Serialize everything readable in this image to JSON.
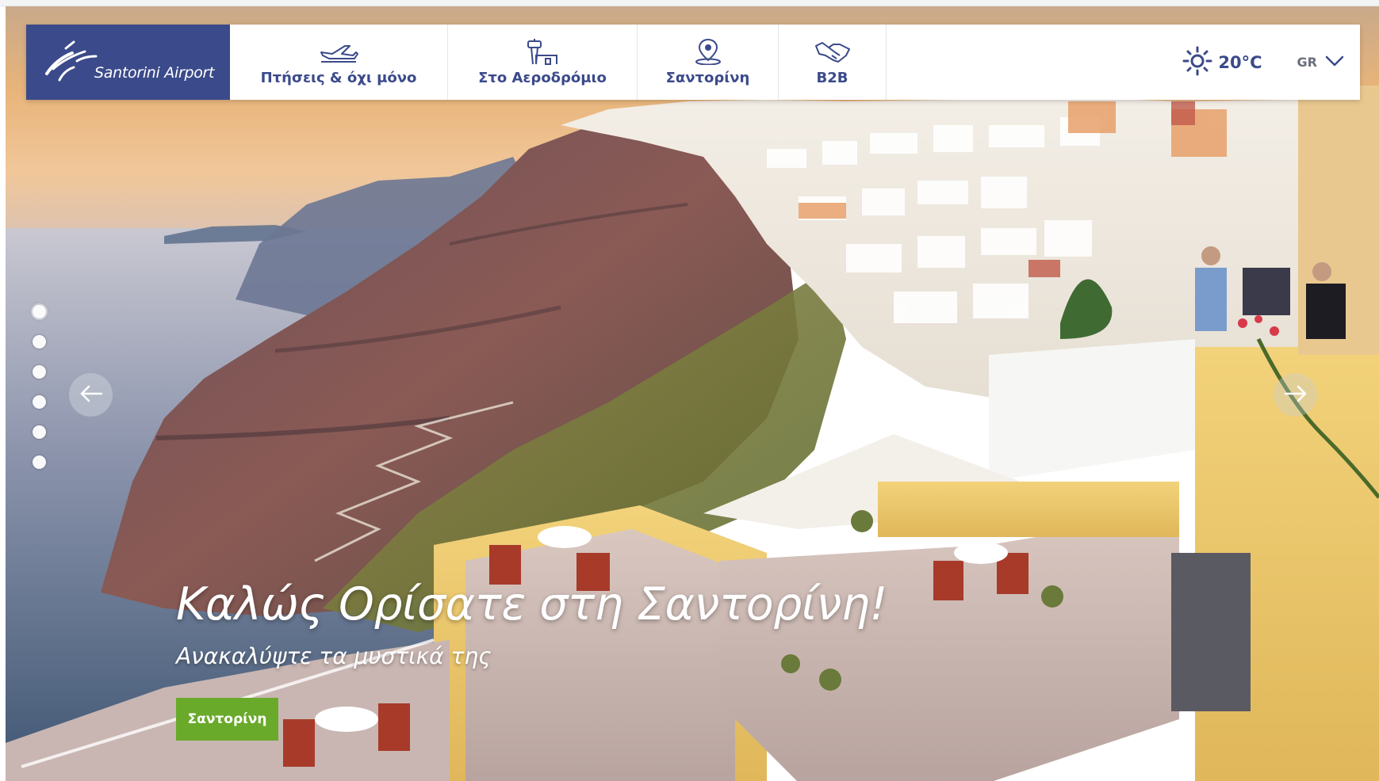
{
  "brand": {
    "name": "Santorini Airport",
    "primary_color": "#3b4a8a",
    "accent_green": "#6aaa2b"
  },
  "nav": {
    "items": [
      {
        "label": "Πτήσεις & όχι μόνο",
        "icon": "airplane-takeoff-icon"
      },
      {
        "label": "Στο Αεροδρόμιο",
        "icon": "control-tower-icon"
      },
      {
        "label": "Σαντορίνη",
        "icon": "location-pin-icon"
      },
      {
        "label": "B2B",
        "icon": "handshake-icon"
      }
    ]
  },
  "weather": {
    "icon": "sun-icon",
    "temperature": "20°C"
  },
  "language": {
    "code": "GR",
    "icon": "chevron-down-icon"
  },
  "slider": {
    "slide_count": 6,
    "active_index": 0,
    "prev_icon": "arrow-left-icon",
    "next_icon": "arrow-right-icon"
  },
  "hero": {
    "title": "Καλώς Ορίσατε στη Σαντορίνη!",
    "subtitle": "Ανακαλύψτε τα μυστικά της",
    "cta_label": "Σαντορίνη"
  }
}
